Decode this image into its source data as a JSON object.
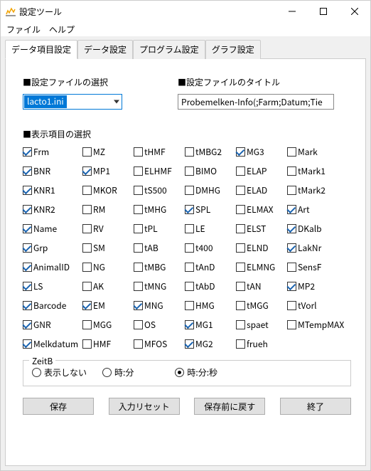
{
  "window": {
    "title": "設定ツール"
  },
  "menu": {
    "file": "ファイル",
    "help": "ヘルプ"
  },
  "tabs": {
    "t0": "データ項目設定",
    "t1": "データ設定",
    "t2": "プログラム設定",
    "t3": "グラフ設定"
  },
  "sections": {
    "file_select": "■設定ファイルの選択",
    "file_title": "■設定ファイルのタイトル",
    "display": "■表示項目の選択"
  },
  "combo": {
    "value": "lacto1.ini"
  },
  "title_field": {
    "value": "Probemelken-Info(;Farm;Datum;Tie"
  },
  "checks": [
    [
      {
        "l": "Frm",
        "c": true
      },
      {
        "l": "MZ",
        "c": false
      },
      {
        "l": "tHMF",
        "c": false
      },
      {
        "l": "tMBG2",
        "c": false
      },
      {
        "l": "MG3",
        "c": true
      },
      {
        "l": "Mark",
        "c": false
      }
    ],
    [
      {
        "l": "BNR",
        "c": true
      },
      {
        "l": "MP1",
        "c": true
      },
      {
        "l": "ELHMF",
        "c": false
      },
      {
        "l": "BIMO",
        "c": false
      },
      {
        "l": "ELAP",
        "c": false
      },
      {
        "l": "tMark1",
        "c": false
      }
    ],
    [
      {
        "l": "KNR1",
        "c": true
      },
      {
        "l": "MKOR",
        "c": false
      },
      {
        "l": "tS500",
        "c": false
      },
      {
        "l": "DMHG",
        "c": false
      },
      {
        "l": "ELAD",
        "c": false
      },
      {
        "l": "tMark2",
        "c": false
      }
    ],
    [
      {
        "l": "KNR2",
        "c": true
      },
      {
        "l": "RM",
        "c": false
      },
      {
        "l": "tMHG",
        "c": false
      },
      {
        "l": "SPL",
        "c": true
      },
      {
        "l": "ELMAX",
        "c": false
      },
      {
        "l": "Art",
        "c": true
      }
    ],
    [
      {
        "l": "Name",
        "c": true
      },
      {
        "l": "RV",
        "c": false
      },
      {
        "l": "tPL",
        "c": false
      },
      {
        "l": "LE",
        "c": false
      },
      {
        "l": "ELST",
        "c": false
      },
      {
        "l": "DKalb",
        "c": true
      }
    ],
    [
      {
        "l": "Grp",
        "c": true
      },
      {
        "l": "SM",
        "c": false
      },
      {
        "l": "tAB",
        "c": false
      },
      {
        "l": "t400",
        "c": false
      },
      {
        "l": "ELND",
        "c": false
      },
      {
        "l": "LakNr",
        "c": true
      }
    ],
    [
      {
        "l": "AnimalID",
        "c": true
      },
      {
        "l": "NG",
        "c": false
      },
      {
        "l": "tMBG",
        "c": false
      },
      {
        "l": "tAnD",
        "c": false
      },
      {
        "l": "ELMNG",
        "c": false
      },
      {
        "l": "SensF",
        "c": false
      }
    ],
    [
      {
        "l": "LS",
        "c": true
      },
      {
        "l": "AK",
        "c": false
      },
      {
        "l": "tMNG",
        "c": false
      },
      {
        "l": "tAbD",
        "c": false
      },
      {
        "l": "tAN",
        "c": false
      },
      {
        "l": "MP2",
        "c": true
      }
    ],
    [
      {
        "l": "Barcode",
        "c": true
      },
      {
        "l": "EM",
        "c": true
      },
      {
        "l": "MNG",
        "c": true
      },
      {
        "l": "HMG",
        "c": false
      },
      {
        "l": "tMGG",
        "c": false
      },
      {
        "l": "tVorl",
        "c": false
      }
    ],
    [
      {
        "l": "GNR",
        "c": true
      },
      {
        "l": "MGG",
        "c": false
      },
      {
        "l": "OS",
        "c": false
      },
      {
        "l": "MG1",
        "c": true
      },
      {
        "l": "spaet",
        "c": false
      },
      {
        "l": "MTempMAX",
        "c": false
      }
    ],
    [
      {
        "l": "Melkdatum",
        "c": true
      },
      {
        "l": "HMF",
        "c": false
      },
      {
        "l": "MFOS",
        "c": false
      },
      {
        "l": "MG2",
        "c": true
      },
      {
        "l": "frueh",
        "c": false
      }
    ]
  ],
  "zeitb": {
    "title": "ZeitB",
    "opts": [
      {
        "l": "表示しない",
        "c": false
      },
      {
        "l": "時:分",
        "c": false
      },
      {
        "l": "時:分:秒",
        "c": true
      }
    ]
  },
  "buttons": {
    "save": "保存",
    "reset": "入力リセット",
    "revert": "保存前に戻す",
    "close": "終了"
  }
}
